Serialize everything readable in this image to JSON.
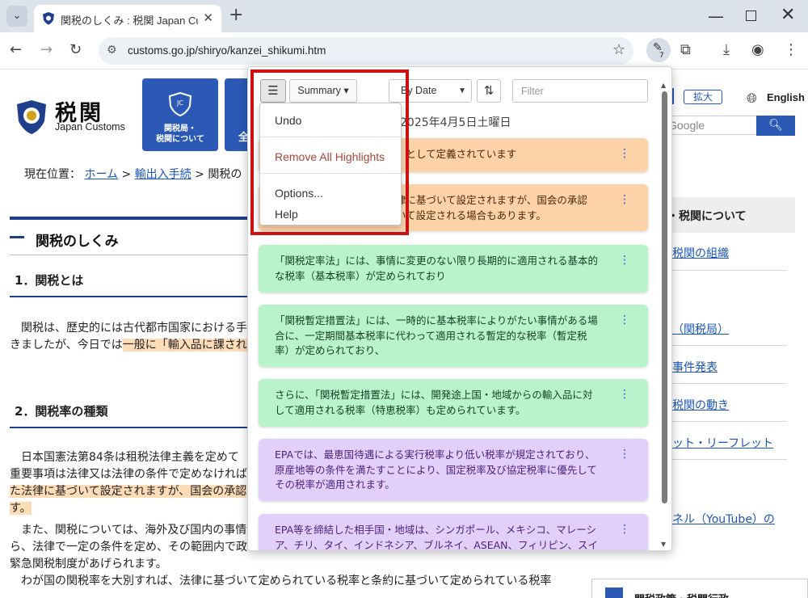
{
  "browser": {
    "tab_title": "関税のしくみ : 税関 Japan Customs",
    "url": "customs.go.jp/shiryo/kanzei_shikumi.htm",
    "extension_badge": "7"
  },
  "site": {
    "logo_kanji": "税関",
    "logo_en": "Japan Customs",
    "nav_tile_1": "関税局・\n税関について",
    "nav_tile_2": "全",
    "zoom_label": "拡大",
    "lang_label": "English",
    "search_placeholder": "Google",
    "breadcrumb": {
      "prefix": "現在位置：",
      "home": "ホーム",
      "sep": " > ",
      "section": "輸出入手続",
      "current": "関税の"
    },
    "page_title": "関税のしくみ",
    "section_1": "1．関税とは",
    "para_1a": "関税は、歴史的には古代都市国家における手",
    "para_1b_plain": "きましたが、今日では",
    "para_1b_hl": "一般に「輸入品に課され",
    "section_2": "2．関税率の種類",
    "p2_1": "日本国憲法第84条は租税法律主義を定めて",
    "p2_2": "重要事項は法律又は法律の条件で定めなければ",
    "p2_3_hl": "た法律に基づいて設定されますが、国会の承認",
    "p2_4_hl": "す。",
    "p2_5": "また、関税については、海外及び国内の事情",
    "p2_6": "ら、法律で一定の条件を定め、その範囲内で政令により関税率の変更を行う制度があります。この例として",
    "p2_7": "緊急関税制度があげられます。",
    "p2_8": "わが国の関税率を大別すれば、法律に基づいて定められている税率と条約に基づいて定められている税率",
    "sidebar_head": "・税関について",
    "side_links": [
      "税関の組織",
      "（関税局）",
      "事件発表",
      "税関の動き",
      "ット・リーフレット",
      "ネル（YouTube）の"
    ],
    "bottom_box": "関税政策・税関行政"
  },
  "popup": {
    "summary_label": "Summary",
    "sort_label": "By Date",
    "filter_placeholder": "Filter",
    "date_line": "2025年4月5日土曜日",
    "menu": {
      "undo": "Undo",
      "remove_all": "Remove All Highlights",
      "options": "Options...",
      "help": "Help"
    },
    "cards": [
      {
        "color": "orange",
        "text": "　　　　　　　　　　　税」として定義されています"
      },
      {
        "color": "orange",
        "text": "　　　　　　　　　　　法律に基づいて設定されますが、国会の承認\n　　　　　　　　　　　ついて設定される場合もあります。"
      },
      {
        "color": "green",
        "text": "「関税定率法」には、事情に変更のない限り長期的に適用される基本的\nな税率（基本税率）が定められており"
      },
      {
        "color": "green",
        "text": "「関税暫定措置法」には、一時的に基本税率によりがたい事情がある場\n合に、一定期間基本税率に代わって適用される暫定的な税率（暫定税\n率）が定められており、"
      },
      {
        "color": "green",
        "text": "さらに、「関税暫定措置法」には、開発途上国・地域からの輸入品に対\nして適用される税率（特恵税率）も定められています。"
      },
      {
        "color": "purple",
        "text": "EPAでは、最恵国待遇による実行税率より低い税率が規定されており、\n原産地等の条件を満たすことにより、国定税率及び協定税率に優先して\nその税率が適用されます。"
      },
      {
        "color": "purple",
        "text": "EPA等を締結した相手国・地域は、シンガポール、メキシコ、マレーシ\nア、チリ、タイ、インドネシア、ブルネイ、ASEAN、フィリピン、スイ"
      }
    ]
  },
  "colors": {
    "orange_card": "#fcd2a8",
    "green_card": "#b9f3cc",
    "purple_card": "#e3d0fa",
    "customs_blue": "#2b59b5",
    "red_frame": "#d01010"
  }
}
